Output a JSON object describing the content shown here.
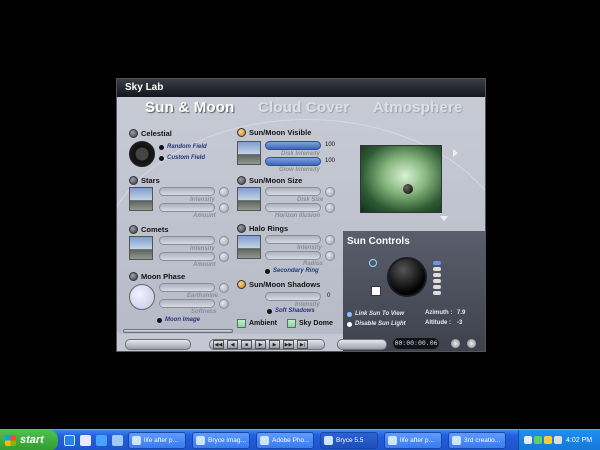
{
  "window": {
    "title": "Sky Lab"
  },
  "tabs": [
    "Sun & Moon",
    "Cloud Cover",
    "Atmosphere"
  ],
  "celestial": {
    "title": "Celestial",
    "options": [
      "Random Field",
      "Custom Field"
    ]
  },
  "stars": {
    "title": "Stars",
    "captions": [
      "Intensity",
      "Amount"
    ]
  },
  "comets": {
    "title": "Comets",
    "captions": [
      "Intensity",
      "Amount"
    ]
  },
  "moon_phase": {
    "title": "Moon Phase",
    "captions": [
      "Earthshine",
      "Softness"
    ],
    "option": "Moon Image"
  },
  "sun_moon_visible": {
    "title": "Sun/Moon Visible",
    "captions": [
      "Disk Intensity",
      "Glow Intensity"
    ],
    "values": [
      "100",
      "100"
    ]
  },
  "sun_moon_size": {
    "title": "Sun/Moon Size",
    "captions": [
      "Disk Size",
      "Horizon Illusion"
    ]
  },
  "halo_rings": {
    "title": "Halo Rings",
    "captions": [
      "Intensity",
      "Radius"
    ],
    "option": "Secondary Ring"
  },
  "sun_moon_shadows": {
    "title": "Sun/Moon Shadows",
    "caption": "Intensity",
    "value": "0",
    "option": "Soft Shadows"
  },
  "checks": {
    "ambient": "Ambient",
    "sky_dome": "Sky Dome"
  },
  "sun_controls": {
    "title": "Sun Controls",
    "options": [
      "Link Sun To View",
      "Disable Sun Light"
    ],
    "azimuth_label": "Azimuth :",
    "azimuth": "7.9",
    "altitude_label": "Altitude :",
    "altitude": "-3"
  },
  "toolbar": {
    "timecode": "00:00:00.06"
  },
  "taskbar": {
    "start": "start",
    "tasks": [
      "life after p...",
      "Bryce imag...",
      "Adobe Pho...",
      "Bryce 5.5",
      "life after p...",
      "3rd creatio..."
    ],
    "clock": "4:02 PM"
  }
}
